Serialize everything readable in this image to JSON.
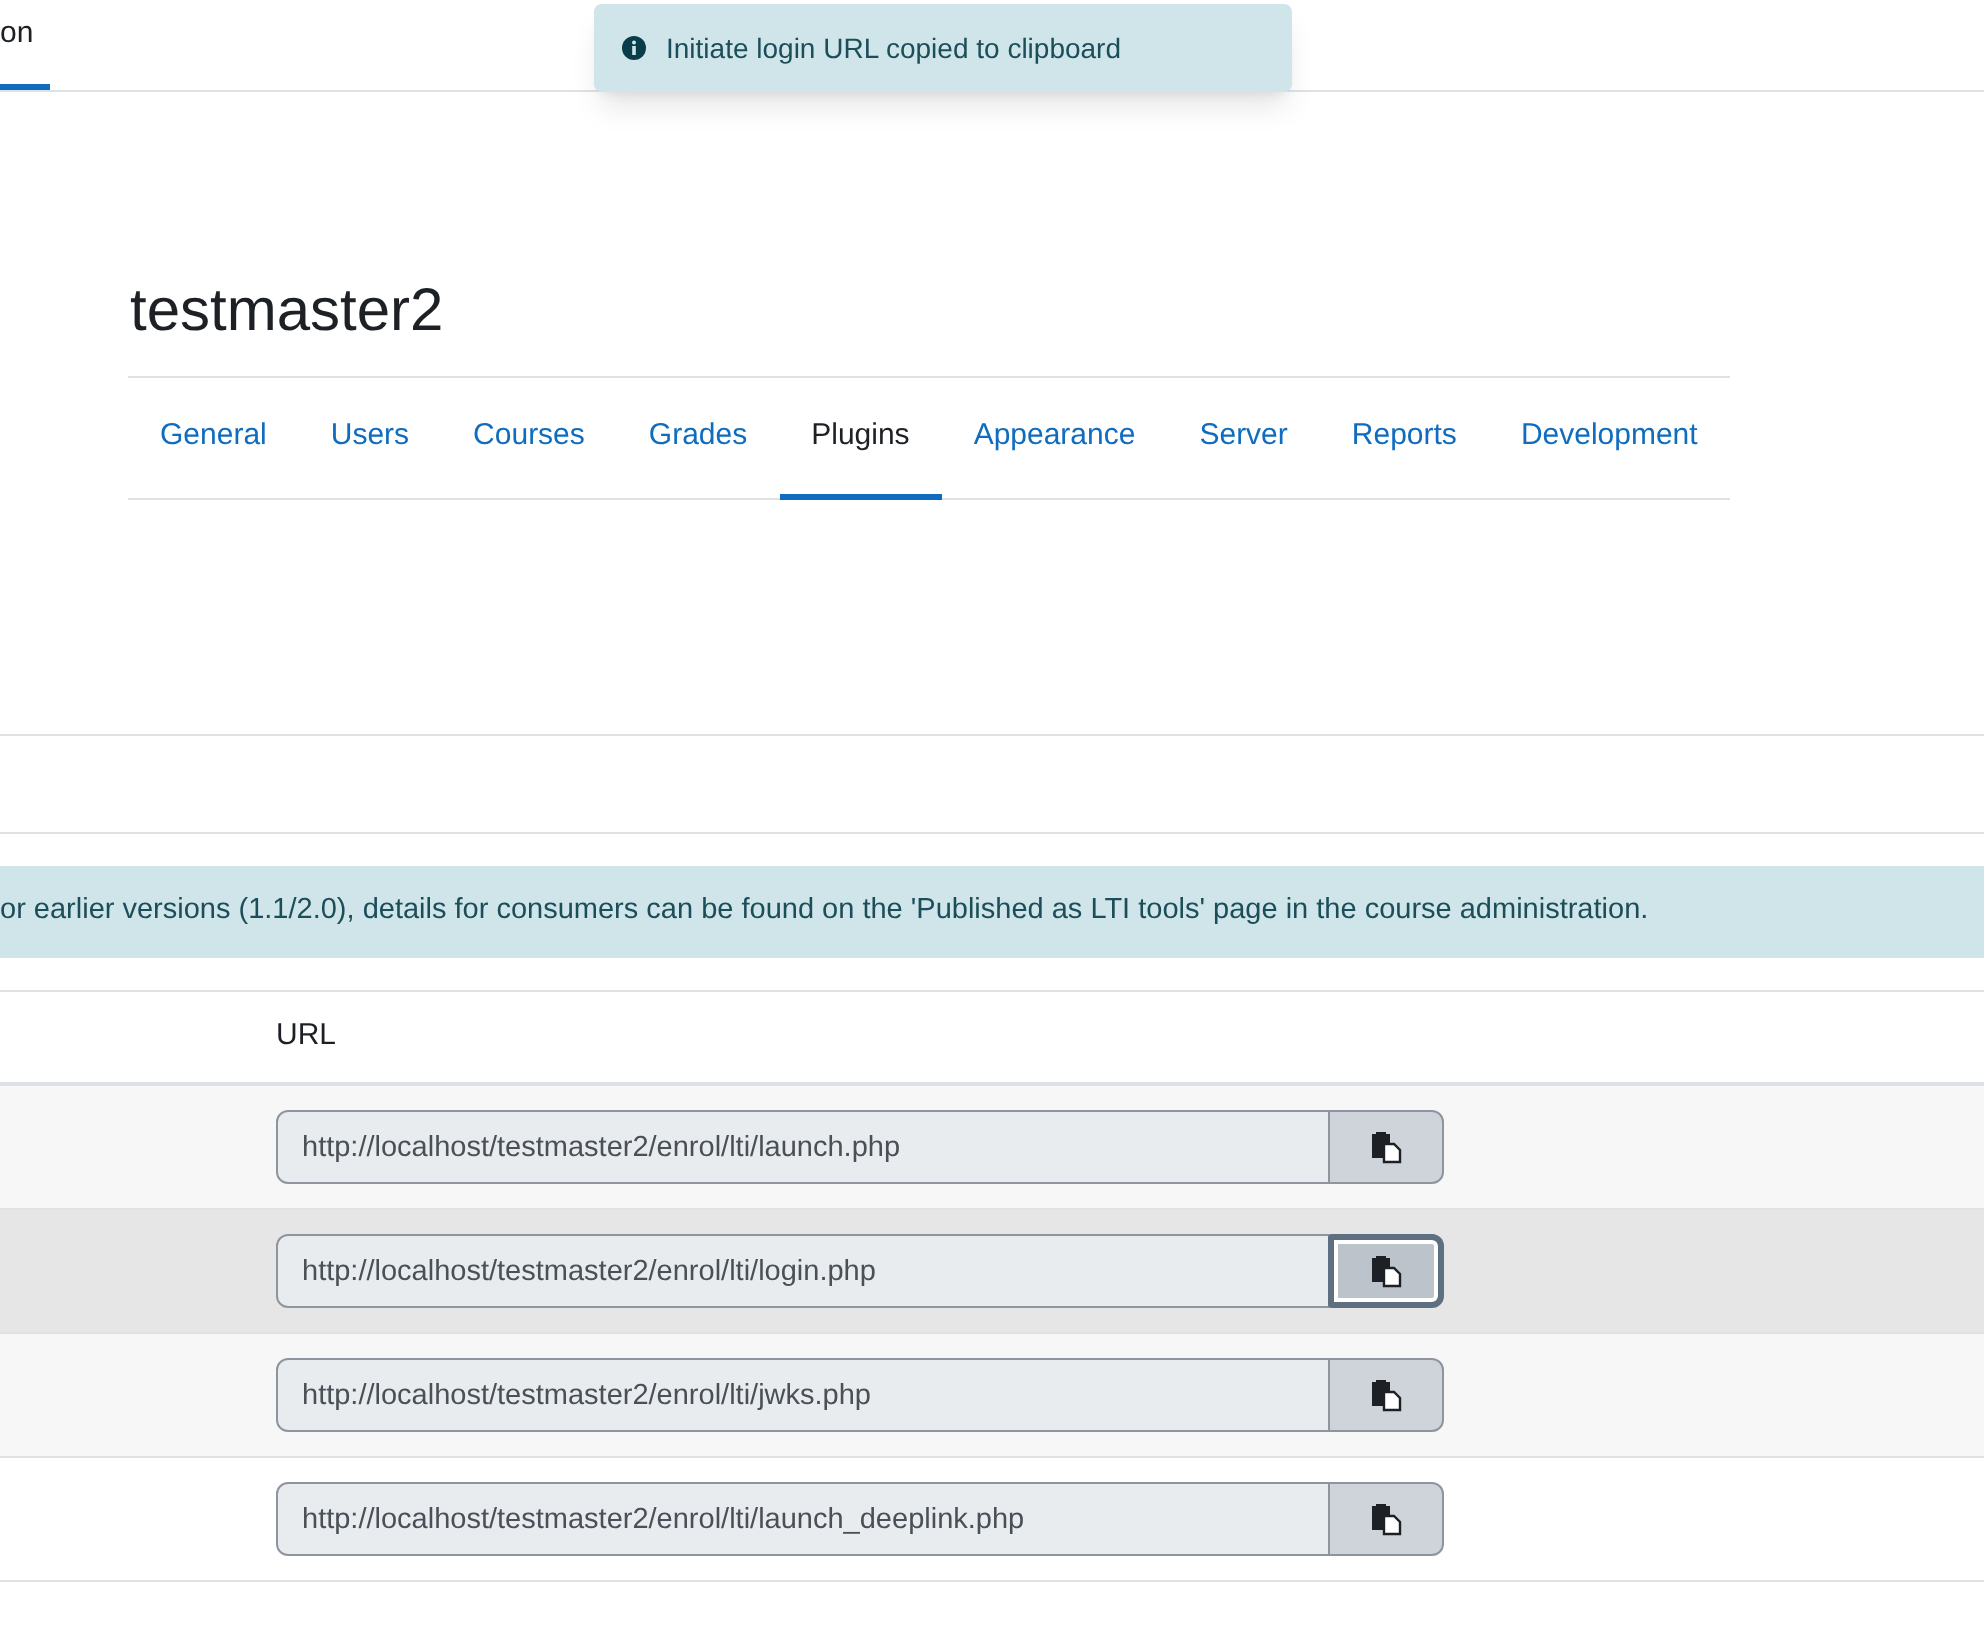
{
  "top_tab": {
    "label": "on",
    "selected": true
  },
  "toast": {
    "message": "Initiate login URL copied to clipboard"
  },
  "heading": "testmaster2",
  "tabs": [
    {
      "label": "General",
      "selected": false
    },
    {
      "label": "Users",
      "selected": false
    },
    {
      "label": "Courses",
      "selected": false
    },
    {
      "label": "Grades",
      "selected": false
    },
    {
      "label": "Plugins",
      "selected": true
    },
    {
      "label": "Appearance",
      "selected": false
    },
    {
      "label": "Server",
      "selected": false
    },
    {
      "label": "Reports",
      "selected": false
    },
    {
      "label": "Development",
      "selected": false
    }
  ],
  "alert": "or earlier versions (1.1/2.0), details for consumers can be found on the 'Published as LTI tools' page in the course administration.",
  "table": {
    "columns": [
      "URL"
    ],
    "rows": [
      {
        "url": "http://localhost/testmaster2/enrol/lti/launch.php",
        "hovered": false,
        "focused": false
      },
      {
        "url": "http://localhost/testmaster2/enrol/lti/login.php",
        "hovered": true,
        "focused": true
      },
      {
        "url": "http://localhost/testmaster2/enrol/lti/jwks.php",
        "hovered": false,
        "focused": false
      },
      {
        "url": "http://localhost/testmaster2/enrol/lti/launch_deeplink.php",
        "hovered": false,
        "focused": false
      }
    ]
  }
}
